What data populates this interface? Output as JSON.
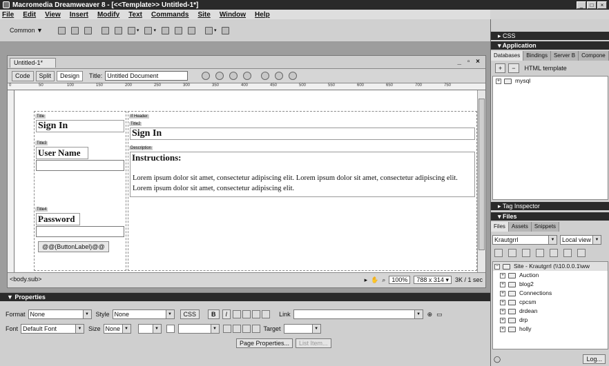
{
  "window": {
    "title": "Macromedia Dreamweaver 8 - [<<Template>> Untitled-1*]",
    "controls": [
      "_",
      "□",
      "×"
    ]
  },
  "menu": [
    "File",
    "Edit",
    "View",
    "Insert",
    "Modify",
    "Text",
    "Commands",
    "Site",
    "Window",
    "Help"
  ],
  "insert_bar": {
    "category": "Common ▼"
  },
  "document": {
    "tab": "Untitled-1*",
    "controls": "_ ▫ ×",
    "view_buttons": [
      "Code",
      "Split",
      "Design"
    ],
    "title_label": "Title:",
    "title_value": "Untitled Document",
    "ruler_ticks": [
      "0",
      "50",
      "100",
      "150",
      "200",
      "250",
      "300",
      "350",
      "400",
      "450",
      "500",
      "550",
      "600",
      "650",
      "700",
      "750"
    ],
    "status_tag": "<body.sub>",
    "zoom": "100%",
    "size": "788 x 314 ▾",
    "download": "3K / 1 sec"
  },
  "template": {
    "title_tag": "Title",
    "sign_in": "Sign In",
    "ifheader_tag": "If Header",
    "title2_tag": "Title2",
    "sign_in_2": "Sign In",
    "title3_tag": "Title3",
    "user_name": "User Name",
    "description_tag": "Description",
    "instructions": "Instructions:",
    "lorem": "Lorem ipsum dolor sit amet, consectetur adipiscing elit. Lorem ipsum dolor sit amet, consectetur adipiscing elit. Lorem ipsum dolor sit amet, consectetur adipiscing elit.",
    "title4_tag": "Title4",
    "password": "Password",
    "button_label": "@@(ButtonLabel)@@"
  },
  "properties": {
    "header": "▼ Properties",
    "format_label": "Format",
    "format_value": "None",
    "style_label": "Style",
    "style_value": "None",
    "css_btn": "CSS",
    "link_label": "Link",
    "font_label": "Font",
    "font_value": "Default Font",
    "size_label": "Size",
    "size_value": "None",
    "target_label": "Target",
    "page_props_btn": "Page Properties...",
    "list_item_btn": "List Item..."
  },
  "right_panel": {
    "css_header": "▸ CSS",
    "application_header": "▾ Application",
    "app_tabs": [
      "Databases",
      "Bindings",
      "Server B",
      "Compone"
    ],
    "html_template": "HTML template",
    "db_item": "mysql",
    "tag_inspector": "▸ Tag Inspector",
    "files_header": "▾ Files",
    "files_tabs": [
      "Files",
      "Assets",
      "Snippets"
    ],
    "site_select": "Krautgrrl",
    "view_select": "Local view",
    "site_root": "Site - Krautgrrl (\\\\10.0.0.1\\ww",
    "folders": [
      "Auction",
      "blog2",
      "Connections",
      "cpcsm",
      "drdean",
      "drp",
      "holly"
    ],
    "log_btn": "Log..."
  }
}
